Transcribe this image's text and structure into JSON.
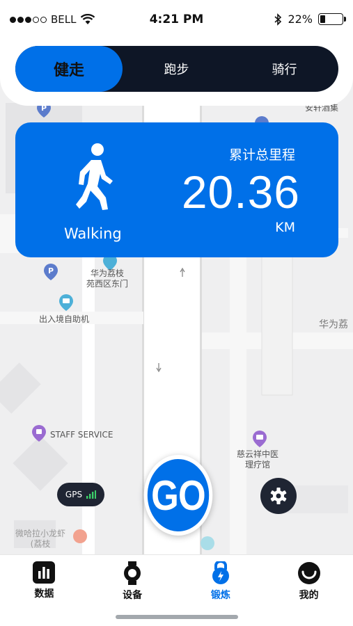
{
  "status_bar": {
    "carrier": "BELL",
    "time": "4:21 PM",
    "battery": "22%",
    "battery_level": 0.22
  },
  "mode_tabs": [
    {
      "label": "健走",
      "active": true
    },
    {
      "label": "跑步",
      "active": false
    },
    {
      "label": "骑行",
      "active": false
    }
  ],
  "stats": {
    "activity": "Walking",
    "total_label": "累计总里程",
    "total_value": "20.36",
    "unit": "KM"
  },
  "map": {
    "labels": {
      "top_cut": "安轩酒集",
      "gate_line1": "华为荔枝",
      "gate_line2": "苑西区东门",
      "kiosk": "出入境自助机",
      "huawei": "华为荔",
      "staff": "STAFF SERVICE",
      "clinic_line1": "慈云祥中医",
      "clinic_line2": "理疗馆",
      "shop_line1": "微哈拉小龙虾",
      "shop_line2": "(荔枝"
    }
  },
  "controls": {
    "gps": "GPS",
    "go": "GO"
  },
  "tab_bar": [
    {
      "label": "数据",
      "icon": "chart-icon",
      "active": false
    },
    {
      "label": "设备",
      "icon": "watch-icon",
      "active": false
    },
    {
      "label": "锻炼",
      "icon": "kettlebell-icon",
      "active": true
    },
    {
      "label": "我的",
      "icon": "smile-icon",
      "active": false
    }
  ],
  "colors": {
    "accent": "#0070e8",
    "dark": "#0e1626"
  }
}
